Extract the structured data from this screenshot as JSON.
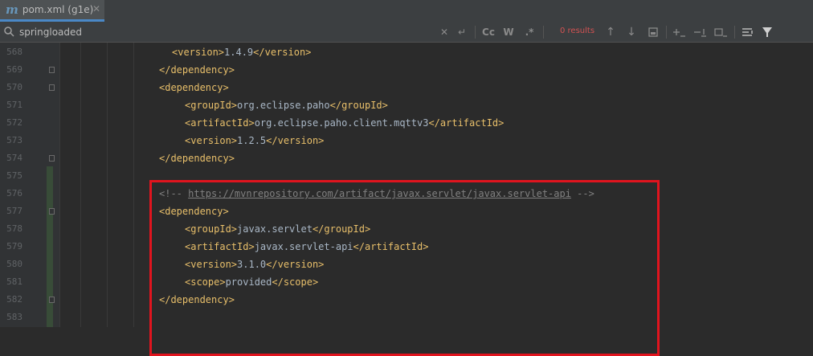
{
  "tab": {
    "icon": "m",
    "label": "pom.xml (g1e)",
    "close": "✕"
  },
  "search": {
    "query": "springloaded",
    "results": "0 results",
    "buttons": [
      "clear-icon",
      "new-line-icon",
      "match-case-icon",
      "whole-words-icon",
      "regex-icon",
      "prev-icon",
      "next-icon",
      "select-all-icon",
      "add-occurrence-icon",
      "remove-occurrence-icon",
      "toggle-selection-icon",
      "multiline-icon",
      "filter-icon"
    ],
    "labels": {
      "clear": "✕",
      "newline": "↵",
      "case": "Cc",
      "words": "W",
      "regex": ".*",
      "prev": "↑",
      "next": "↓"
    }
  },
  "lines": [
    {
      "no": "568",
      "tag_open": "<version>",
      "text": "1.4.9",
      "tag_close": "</version>"
    },
    {
      "no": "569",
      "tag_open": "</dependency>"
    },
    {
      "no": "570",
      "tag_open": "<dependency>"
    },
    {
      "no": "571",
      "tag_open": "<groupId>",
      "text": "org.eclipse.paho",
      "tag_close": "</groupId>"
    },
    {
      "no": "572",
      "tag_open": "<artifactId>",
      "text": "org.eclipse.paho.client.mqttv3",
      "tag_close": "</artifactId>"
    },
    {
      "no": "573",
      "tag_open": "<version>",
      "text": "1.2.5",
      "tag_close": "</version>"
    },
    {
      "no": "574",
      "tag_open": "</dependency>"
    },
    {
      "no": "575"
    },
    {
      "no": "576",
      "comment_open": "<!-- ",
      "link": "https://mvnrepository.com/artifact/javax.servlet/javax.servlet-api",
      "comment_close": " -->"
    },
    {
      "no": "577",
      "tag_open": "<dependency>"
    },
    {
      "no": "578",
      "tag_open": "<groupId>",
      "text": "javax.servlet",
      "tag_close": "</groupId>"
    },
    {
      "no": "579",
      "tag_open": "<artifactId>",
      "text": "javax.servlet-api",
      "tag_close": "</artifactId>"
    },
    {
      "no": "580",
      "tag_open": "<version>",
      "text": "3.1.0",
      "tag_close": "</version>"
    },
    {
      "no": "581",
      "tag_open": "<scope>",
      "text": "provided",
      "tag_close": "</scope>"
    },
    {
      "no": "582",
      "tag_open": "</dependency>"
    },
    {
      "no": "583"
    }
  ],
  "colors": {
    "tag": "#e8bf6a",
    "text": "#a9b7c6",
    "comment": "#808080",
    "highlight": "#e0141e",
    "results": "#d25252"
  }
}
